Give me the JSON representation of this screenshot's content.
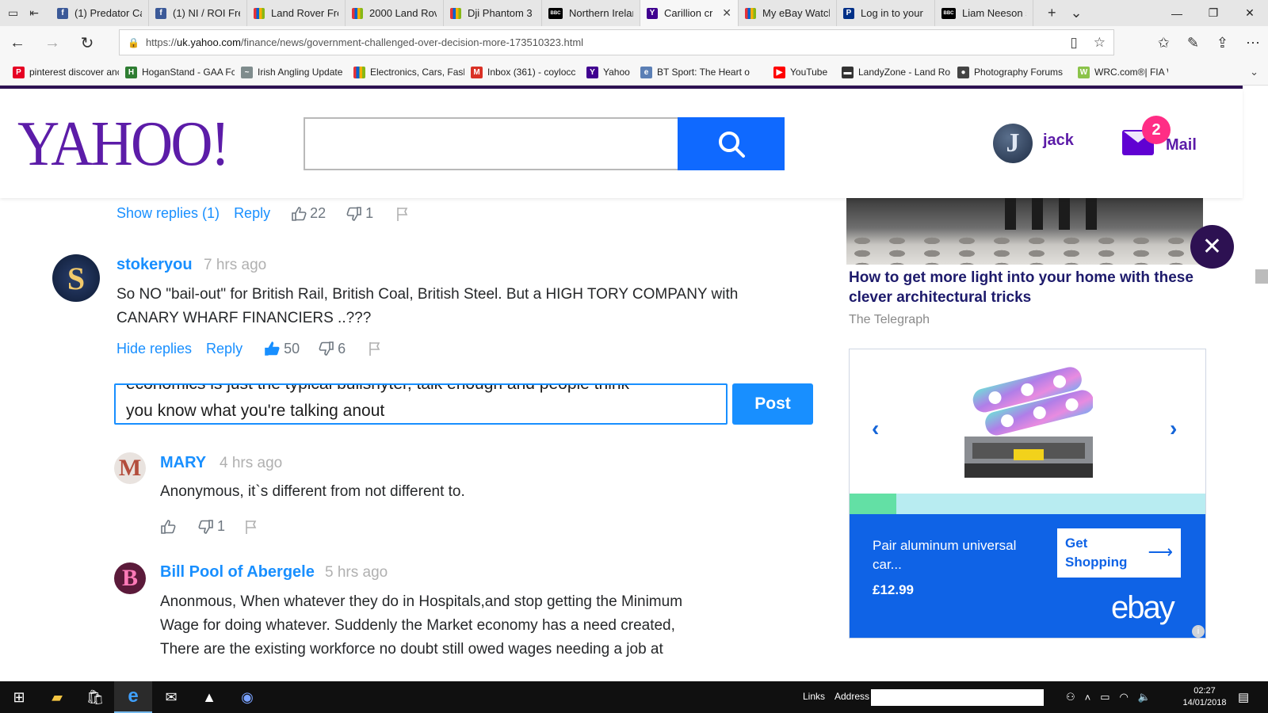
{
  "browser": {
    "tabs": [
      {
        "label": "(1) Predator Ca",
        "icon": "facebook-icon",
        "color": "#3b5998",
        "glyph": "f"
      },
      {
        "label": "(1) NI / ROI Fre",
        "icon": "facebook-icon",
        "color": "#3b5998",
        "glyph": "f"
      },
      {
        "label": "Land Rover Fre",
        "icon": "ebay-icon",
        "color": "#e53238",
        "glyph": ""
      },
      {
        "label": "2000 Land Rov",
        "icon": "ebay-icon",
        "color": "#e53238",
        "glyph": ""
      },
      {
        "label": "Dji Phantom 3",
        "icon": "ebay-icon",
        "color": "#e53238",
        "glyph": ""
      },
      {
        "label": "Northern Irelar",
        "icon": "bbc-icon",
        "color": "#000000",
        "glyph": "BBC"
      },
      {
        "label": "Carillion cr",
        "icon": "yahoo-icon",
        "color": "#400090",
        "glyph": "Y"
      },
      {
        "label": "My eBay Watch",
        "icon": "ebay-icon",
        "color": "#e53238",
        "glyph": ""
      },
      {
        "label": "Log in to your",
        "icon": "paypal-icon",
        "color": "#003087",
        "glyph": "P"
      },
      {
        "label": "Liam Neeson s",
        "icon": "bbc-icon",
        "color": "#000000",
        "glyph": "BBC"
      }
    ],
    "active_tab_index": 6,
    "url_prefix": "https://",
    "url_domain": "uk.yahoo.com",
    "url_path": "/finance/news/government-challenged-over-decision-more-173510323.html",
    "favorites": [
      {
        "label": "pinterest discover anc",
        "color": "#e60023",
        "glyph": "P"
      },
      {
        "label": "HoganStand - GAA Fc",
        "color": "#2e7d32",
        "glyph": "H"
      },
      {
        "label": "Irish Angling Update",
        "color": "#7f8c8d",
        "glyph": "~"
      },
      {
        "label": "Electronics, Cars, Fash",
        "color": "#e53238",
        "glyph": ""
      },
      {
        "label": "Inbox (361) - coylocc",
        "color": "#d93025",
        "glyph": "M"
      },
      {
        "label": "Yahoo",
        "color": "#400090",
        "glyph": "Y"
      },
      {
        "label": "BT Sport: The Heart o",
        "color": "#5b7fb5",
        "glyph": "e"
      },
      {
        "label": "YouTube",
        "color": "#ff0000",
        "glyph": "▶"
      },
      {
        "label": "LandyZone - Land Ro",
        "color": "#333333",
        "glyph": "▬"
      },
      {
        "label": "Photography Forums",
        "color": "#444444",
        "glyph": "●"
      },
      {
        "label": "WRC.com®| FIA Worl",
        "color": "#8bc34a",
        "glyph": "W"
      }
    ]
  },
  "yahoo": {
    "logo": "YAHOO!",
    "user_initial": "J",
    "user_name": "jack",
    "mail_count": "2",
    "mail_label": "Mail"
  },
  "comments": {
    "prev_actions": {
      "show_replies": "Show replies (1)",
      "reply": "Reply",
      "likes": "22",
      "dislikes": "1"
    },
    "main": {
      "author": "stokeryou",
      "ago": "7 hrs ago",
      "avatar_initial": "S",
      "text_line1": "So NO \"bail-out\" for British Rail, British Coal, British Steel. But a HIGH TORY COMPANY with",
      "text_line2": "CANARY WHARF FINANCIERS ..???",
      "hide_replies": "Hide replies",
      "reply": "Reply",
      "likes": "50",
      "dislikes": "6"
    },
    "reply_box": {
      "line1": "economics is just the typical bullshyter, talk enough and people think",
      "line2": "you know what you're talking anout",
      "post_label": "Post"
    },
    "replies": [
      {
        "author": "MARY",
        "ago": "4 hrs ago",
        "avatar_initial": "M",
        "text": "Anonymous, it`s different from not different to.",
        "likes": "",
        "dislikes": "1"
      },
      {
        "author": "Bill Pool of Abergele",
        "ago": "5 hrs ago",
        "avatar_initial": "B",
        "lines": [
          "Anonmous, When whatever they do in Hospitals,and stop getting the Minimum",
          "Wage for doing whatever. Suddenly the Market economy has a need created,",
          "There are the existing workforce no doubt still owed wages needing a job at"
        ]
      }
    ]
  },
  "sidebar": {
    "article_title": "How to get more light into your home with these clever architectural tricks",
    "article_source": "The Telegraph",
    "ad": {
      "product_title": "Pair aluminum universal car...",
      "price": "£12.99",
      "cta": "Get Shopping",
      "brand": "ebay",
      "progress": 0.13
    }
  },
  "taskbar": {
    "links_label": "Links",
    "address_label": "Address",
    "time": "02:27",
    "date": "14/01/2018"
  }
}
